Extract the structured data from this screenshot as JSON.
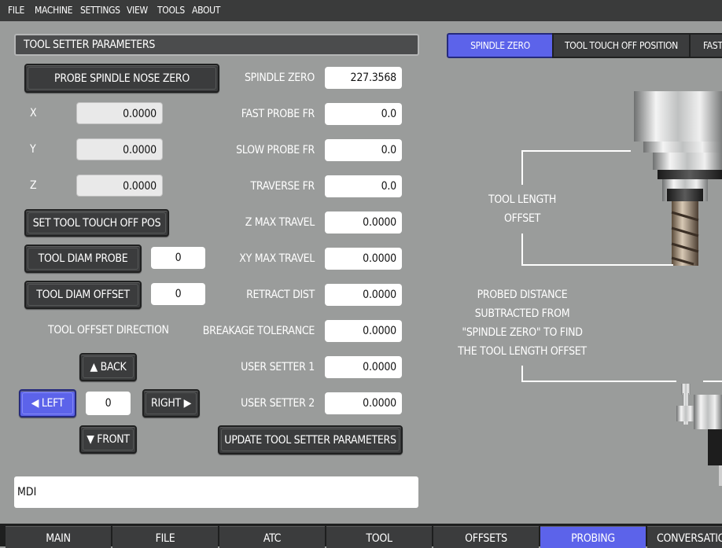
{
  "menu": [
    "FILE",
    "MACHINE",
    "SETTINGS",
    "VIEW",
    "TOOLS",
    "ABOUT"
  ],
  "panel_title": "TOOL SETTER PARAMETERS",
  "left": {
    "probe_button": "PROBE SPINDLE NOSE ZERO",
    "x_label": "X",
    "x_value": "0.0000",
    "y_label": "Y",
    "y_value": "0.0000",
    "z_label": "Z",
    "z_value": "0.0000",
    "set_touch_button": "SET TOOL TOUCH OFF POS",
    "diam_probe_button": "TOOL DIAM PROBE",
    "diam_probe_value": "0",
    "diam_offset_button": "TOOL DIAM OFFSET",
    "diam_offset_value": "0",
    "direction_label": "TOOL OFFSET DIRECTION",
    "back": "BACK",
    "left": "LEFT",
    "right": "RIGHT",
    "front": "FRONT",
    "direction_value": "0"
  },
  "params": [
    {
      "label": "SPINDLE ZERO",
      "value": "227.3568"
    },
    {
      "label": "FAST PROBE FR",
      "value": "0.0"
    },
    {
      "label": "SLOW PROBE FR",
      "value": "0.0"
    },
    {
      "label": "TRAVERSE FR",
      "value": "0.0"
    },
    {
      "label": "Z MAX TRAVEL",
      "value": "0.0000"
    },
    {
      "label": "XY MAX TRAVEL",
      "value": "0.0000"
    },
    {
      "label": "RETRACT DIST",
      "value": "0.0000"
    },
    {
      "label": "BREAKAGE TOLERANCE",
      "value": "0.0000"
    },
    {
      "label": "USER SETTER 1",
      "value": "0.0000"
    },
    {
      "label": "USER SETTER 2",
      "value": "0.0000"
    }
  ],
  "update_button": "UPDATE TOOL SETTER PARAMETERS",
  "top_tabs": [
    "SPINDLE ZERO",
    "TOOL TOUCH OFF POSITION",
    "FAST"
  ],
  "diagram": {
    "tlo_line1": "TOOL LENGTH",
    "tlo_line2": "OFFSET",
    "probed_lines": [
      "PROBED DISTANCE",
      "SUBTRACTED FROM",
      "\"SPINDLE ZERO\" TO FIND",
      "THE TOOL LENGTH OFFSET"
    ]
  },
  "mdi_label": "MDI",
  "bottom_tabs": [
    "MAIN",
    "FILE",
    "ATC",
    "TOOL",
    "OFFSETS",
    "PROBING",
    "CONVERSATIONAL"
  ],
  "colors": {
    "accent": "#5c63ea",
    "background": "#9a9c9b",
    "button": "#3b3c3d"
  }
}
